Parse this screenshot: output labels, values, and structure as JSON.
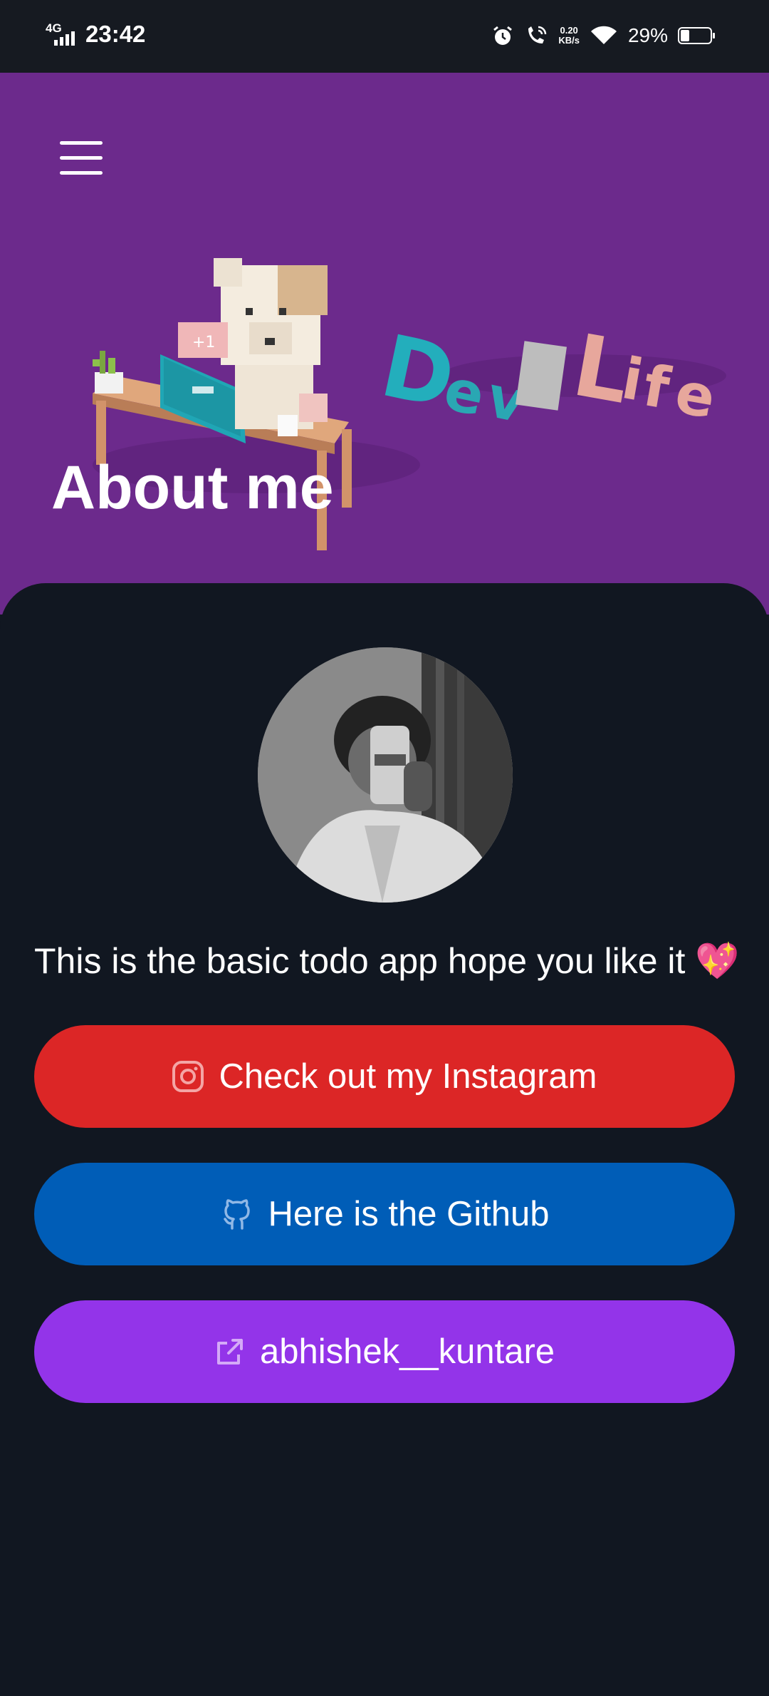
{
  "status_bar": {
    "network": "4G",
    "time": "23:42",
    "speed_value": "0.20",
    "speed_unit": "KB/s",
    "battery_percent": "29%",
    "battery_level": 0.29
  },
  "header": {
    "title": "About me",
    "banner_text": "Dev Life",
    "background_color": "#6c2a8c"
  },
  "about": {
    "description": "This is the basic todo app hope you like it 💖"
  },
  "buttons": [
    {
      "label": "Check out my Instagram",
      "icon": "instagram-icon",
      "color": "#dc2626"
    },
    {
      "label": "Here is the Github",
      "icon": "github-icon",
      "color": "#005db7"
    },
    {
      "label": "abhishek__kuntare",
      "icon": "external-link-icon",
      "color": "#9334e9"
    }
  ]
}
